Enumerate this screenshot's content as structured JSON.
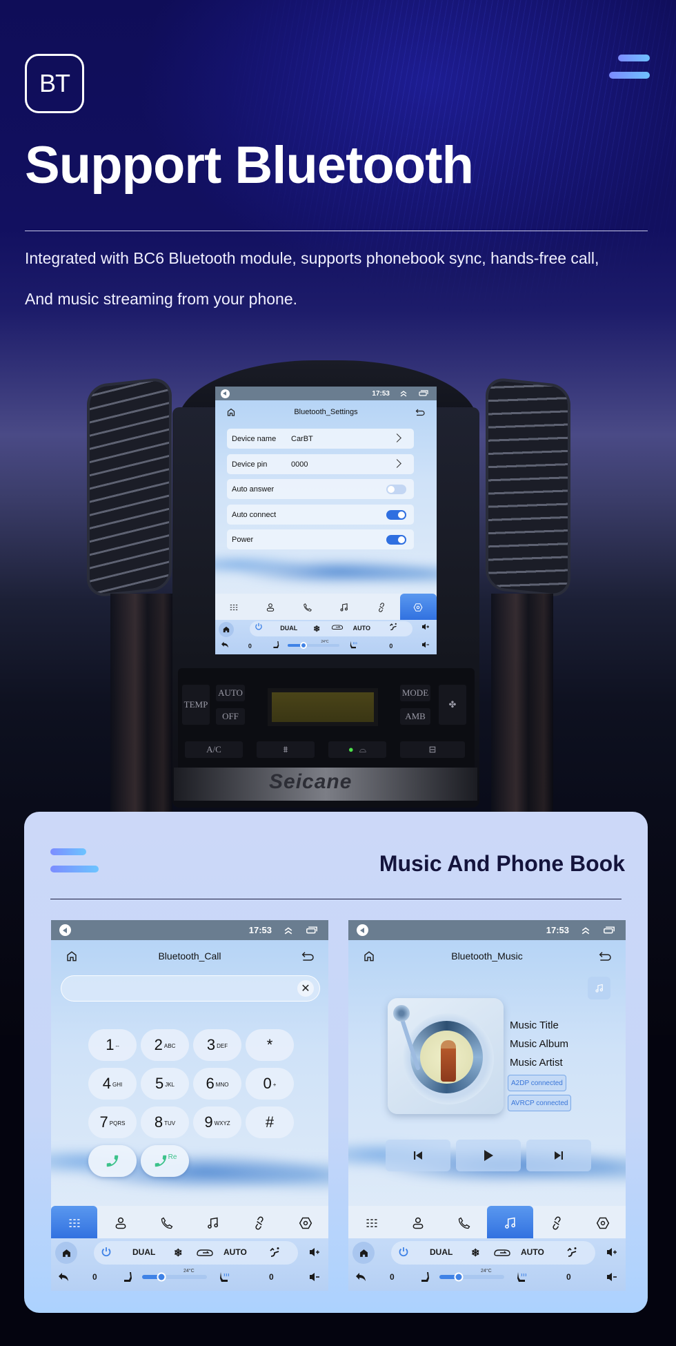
{
  "hero": {
    "badge": "BT",
    "title": "Support Bluetooth",
    "description_lines": [
      "Integrated with BC6 Bluetooth module, supports phonebook sync, hands-free call,",
      "And music streaming from your phone."
    ]
  },
  "car_panel": {
    "brand": "Seicane",
    "buttons": [
      "AUTO",
      "TEMP",
      "OFF",
      "MODE",
      "AMB",
      "A/C"
    ]
  },
  "status_bar": {
    "time": "17:53"
  },
  "bt_settings": {
    "title": "Bluetooth_Settings",
    "rows": [
      {
        "label": "Device name",
        "value": "CarBT",
        "type": "link"
      },
      {
        "label": "Device pin",
        "value": "0000",
        "type": "link"
      },
      {
        "label": "Auto answer",
        "type": "toggle",
        "on": false
      },
      {
        "label": "Auto connect",
        "type": "toggle",
        "on": true
      },
      {
        "label": "Power",
        "type": "toggle",
        "on": true
      }
    ],
    "active_nav": "settings"
  },
  "nav_items": [
    "dialpad",
    "contacts",
    "call-log",
    "music",
    "link",
    "settings"
  ],
  "climate": {
    "dual": "DUAL",
    "auto": "AUTO",
    "temp": "24°C",
    "left_value": "0",
    "right_value": "0",
    "fan_level_percent": 30
  },
  "card": {
    "title": "Music And Phone Book"
  },
  "bt_call": {
    "title": "Bluetooth_Call",
    "input_value": "",
    "keys": [
      {
        "digit": "1",
        "letters": "--"
      },
      {
        "digit": "2",
        "letters": "ABC"
      },
      {
        "digit": "3",
        "letters": "DEF"
      },
      {
        "digit": "*",
        "letters": ""
      },
      {
        "digit": "4",
        "letters": "GHI"
      },
      {
        "digit": "5",
        "letters": "JKL"
      },
      {
        "digit": "6",
        "letters": "MNO"
      },
      {
        "digit": "0",
        "letters": "+"
      },
      {
        "digit": "7",
        "letters": "PQRS"
      },
      {
        "digit": "8",
        "letters": "TUV"
      },
      {
        "digit": "9",
        "letters": "WXYZ"
      },
      {
        "digit": "#",
        "letters": ""
      }
    ],
    "redial_label": "Re",
    "active_nav": "dialpad"
  },
  "bt_music": {
    "title": "Bluetooth_Music",
    "track_title": "Music Title",
    "album": "Music Album",
    "artist": "Music Artist",
    "badges": [
      "A2DP connected",
      "AVRCP connected"
    ],
    "active_nav": "music"
  },
  "colors": {
    "accent": "#2f6fe0",
    "call_green": "#3cc28a",
    "status_bar": "#6a7d90"
  }
}
